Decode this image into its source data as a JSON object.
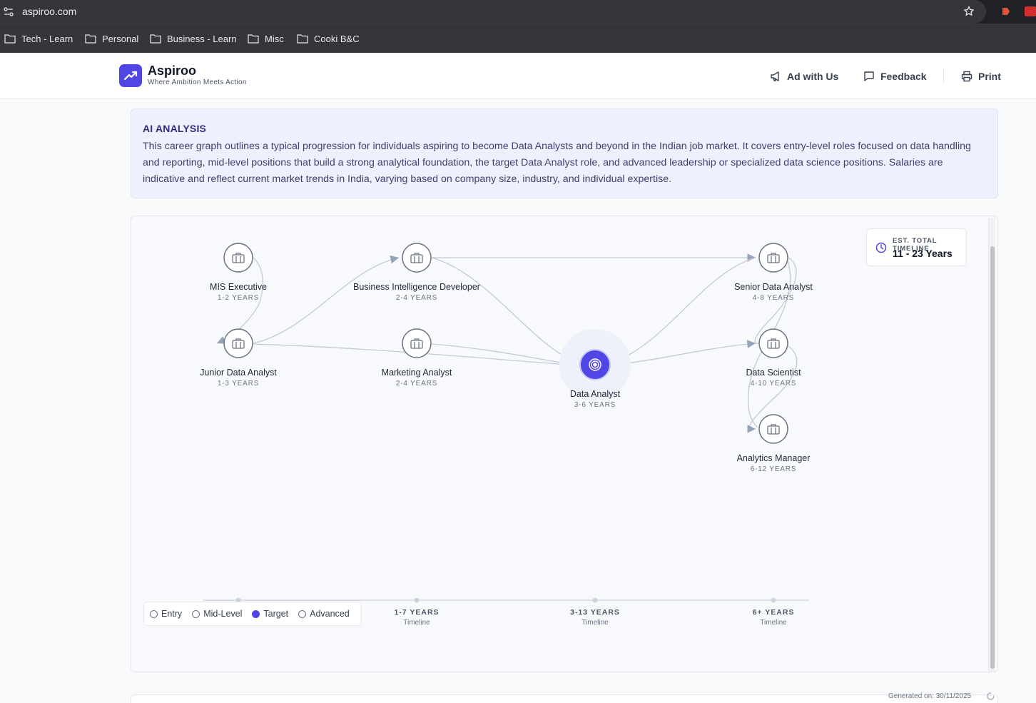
{
  "browser": {
    "url": "aspiroo.com",
    "bookmarks": [
      "Tech - Learn",
      "Personal",
      "Business - Learn",
      "Misc",
      "Cooki B&C"
    ]
  },
  "header": {
    "brand": "Aspiroo",
    "tagline": "Where Ambition Meets Action",
    "ad_label": "Ad with Us",
    "feedback_label": "Feedback",
    "print_label": "Print"
  },
  "analysis": {
    "title": "AI ANALYSIS",
    "text": "This career graph outlines a typical progression for individuals aspiring to become Data Analysts and beyond in the Indian job market. It covers entry-level roles focused on data handling and reporting, mid-level positions that build a strong analytical foundation, the target Data Analyst role, and advanced leadership or specialized data science positions. Salaries are indicative and reflect current market trends in India, varying based on company size, industry, and individual expertise."
  },
  "graph": {
    "timeline_label": "EST. TOTAL TIMELINE",
    "timeline_value": "11 - 23 Years",
    "nodes": [
      {
        "name": "MIS Executive",
        "years": "1-2 YEARS",
        "level": "Entry"
      },
      {
        "name": "Junior Data Analyst",
        "years": "1-3 YEARS",
        "level": "Entry"
      },
      {
        "name": "Business Intelligence Developer",
        "years": "2-4 YEARS",
        "level": "Mid-Level"
      },
      {
        "name": "Marketing Analyst",
        "years": "2-4 YEARS",
        "level": "Mid-Level"
      },
      {
        "name": "Data Analyst",
        "years": "3-6 YEARS",
        "level": "Target"
      },
      {
        "name": "Senior Data Analyst",
        "years": "4-8 YEARS",
        "level": "Advanced"
      },
      {
        "name": "Data Scientist",
        "years": "4-10 YEARS",
        "level": "Advanced"
      },
      {
        "name": "Analytics Manager",
        "years": "6-12 YEARS",
        "level": "Advanced"
      }
    ],
    "legend": [
      "Entry",
      "Mid-Level",
      "Target",
      "Advanced"
    ],
    "axis": [
      {
        "label": "1-7 YEARS",
        "sub": "Timeline"
      },
      {
        "label": "3-13 YEARS",
        "sub": "Timeline"
      },
      {
        "label": "6+ YEARS",
        "sub": "Timeline"
      }
    ]
  },
  "footer": {
    "generated": "Generated on: 30/11/2025"
  }
}
